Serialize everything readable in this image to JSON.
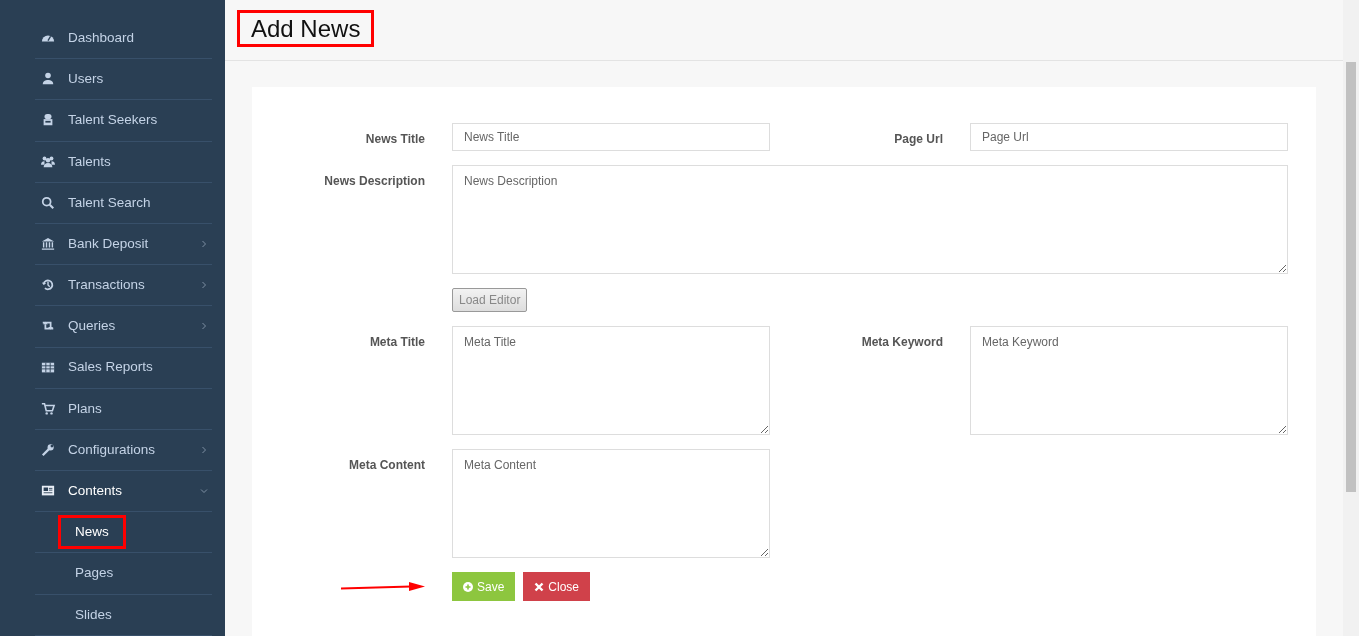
{
  "sidebar": {
    "items": [
      {
        "label": "Dashboard",
        "selected": false
      },
      {
        "label": "Users",
        "selected": false
      },
      {
        "label": "Talent Seekers",
        "selected": false
      },
      {
        "label": "Talents",
        "selected": false
      },
      {
        "label": "Talent Search",
        "selected": false
      },
      {
        "label": "Bank Deposit",
        "selected": false,
        "expanded": false
      },
      {
        "label": "Transactions",
        "selected": false,
        "expanded": false
      },
      {
        "label": "Queries",
        "selected": false,
        "expanded": false
      },
      {
        "label": "Sales Reports",
        "selected": false
      },
      {
        "label": "Plans",
        "selected": false
      },
      {
        "label": "Configurations",
        "selected": false,
        "expanded": false
      },
      {
        "label": "Contents",
        "selected": true,
        "expanded": true,
        "children": [
          {
            "label": "News",
            "selected": true,
            "annotated": true
          },
          {
            "label": "Pages",
            "selected": false,
            "annotated": false
          },
          {
            "label": "Slides",
            "selected": false,
            "annotated": false
          }
        ]
      }
    ]
  },
  "header": {
    "title": "Add News",
    "annotated": true
  },
  "form": {
    "news_title": {
      "label": "News Title",
      "placeholder": "News Title"
    },
    "page_url": {
      "label": "Page Url",
      "placeholder": "Page Url"
    },
    "news_description": {
      "label": "News Description",
      "placeholder": "News Description"
    },
    "load_editor": {
      "label": "Load Editor",
      "disabled": true
    },
    "meta_title": {
      "label": "Meta Title",
      "placeholder": "Meta Title"
    },
    "meta_keyword": {
      "label": "Meta Keyword",
      "placeholder": "Meta Keyword"
    },
    "meta_content": {
      "label": "Meta Content",
      "placeholder": "Meta Content"
    },
    "save_arrow": true,
    "buttons": [
      {
        "label": "Save",
        "kind": "save"
      },
      {
        "label": "Close",
        "kind": "close"
      }
    ]
  }
}
